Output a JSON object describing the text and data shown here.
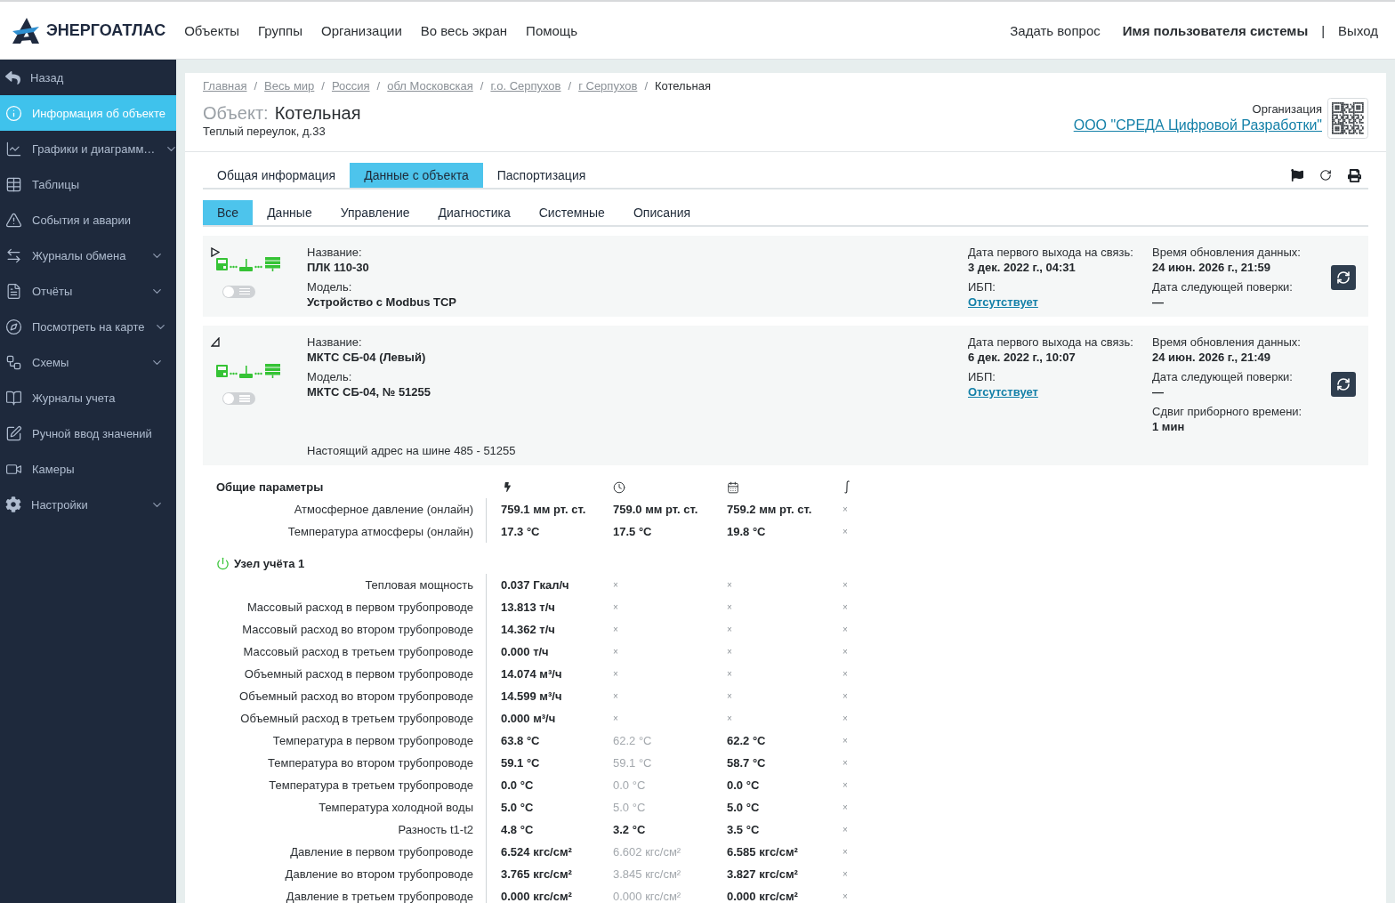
{
  "header": {
    "logo": "ЭНЕРГОАТЛАС",
    "nav": [
      "Объекты",
      "Группы",
      "Организации",
      "Во весь экран",
      "Помощь"
    ],
    "ask": "Задать вопрос",
    "user": "Имя пользователя системы",
    "separator": "|",
    "logout": "Выход"
  },
  "sidebar": {
    "items": [
      {
        "label": "Назад",
        "selected": false,
        "submenu": false
      },
      {
        "label": "Информация об объекте",
        "selected": true,
        "submenu": false
      },
      {
        "label": "Графики и диаграмм…",
        "selected": false,
        "submenu": true
      },
      {
        "label": "Таблицы",
        "selected": false,
        "submenu": false
      },
      {
        "label": "События и аварии",
        "selected": false,
        "submenu": false
      },
      {
        "label": "Журналы обмена",
        "selected": false,
        "submenu": true
      },
      {
        "label": "Отчёты",
        "selected": false,
        "submenu": true
      },
      {
        "label": "Посмотреть на карте",
        "selected": false,
        "submenu": true
      },
      {
        "label": "Схемы",
        "selected": false,
        "submenu": true
      },
      {
        "label": "Журналы учета",
        "selected": false,
        "submenu": false
      },
      {
        "label": "Ручной ввод значений",
        "selected": false,
        "submenu": false
      },
      {
        "label": "Камеры",
        "selected": false,
        "submenu": false
      },
      {
        "label": "Настройки",
        "selected": false,
        "submenu": true
      }
    ]
  },
  "breadcrumb": [
    {
      "kind": "link",
      "label": "Главная"
    },
    {
      "kind": "separator",
      "label": "/"
    },
    {
      "kind": "link",
      "label": "Весь мир"
    },
    {
      "kind": "separator",
      "label": "/"
    },
    {
      "kind": "link",
      "label": "Россия"
    },
    {
      "kind": "separator",
      "label": "/"
    },
    {
      "kind": "link",
      "label": "обл Московская"
    },
    {
      "kind": "separator",
      "label": "/"
    },
    {
      "kind": "link",
      "label": "г.о. Серпухов"
    },
    {
      "kind": "separator",
      "label": "/"
    },
    {
      "kind": "link",
      "label": "г Серпухов"
    },
    {
      "kind": "separator",
      "label": "/"
    },
    {
      "kind": "current",
      "label": "Котельная"
    }
  ],
  "object": {
    "label": "Объект:",
    "name": "Котельная",
    "address": "Теплый переулок, д.33"
  },
  "organization": {
    "label": "Организация",
    "name": "ООО \"СРЕДА Цифровой Разработки\""
  },
  "tabs": [
    {
      "label": "Общая информация",
      "selected": false
    },
    {
      "label": "Данные с объекта",
      "selected": true
    },
    {
      "label": "Паспортизация",
      "selected": false
    }
  ],
  "subtabs": [
    {
      "label": "Все",
      "selected": true
    },
    {
      "label": "Данные",
      "selected": false
    },
    {
      "label": "Управление",
      "selected": false
    },
    {
      "label": "Диагностика",
      "selected": false
    },
    {
      "label": "Системные",
      "selected": false
    },
    {
      "label": "Описания",
      "selected": false
    }
  ],
  "devices": [
    {
      "expanded": false,
      "enabled": false,
      "main": [
        {
          "label": "Название:",
          "value": "ПЛК 110-30"
        },
        {
          "label": "Модель:",
          "value": "Устройство с Modbus TCP"
        }
      ],
      "info": [
        {
          "label": "Дата первого выхода на связь:",
          "value": "3 дек. 2022 г., 04:31",
          "kind": "text"
        },
        {
          "label": "ИБП:",
          "value": "Отсутствует",
          "kind": "link"
        }
      ],
      "status": [
        {
          "label": "Время обновления данных:",
          "value": "24 июн. 2026 г., 21:59"
        },
        {
          "label": "Дата следующей поверки:",
          "value": "—"
        }
      ]
    },
    {
      "expanded": true,
      "enabled": false,
      "main": [
        {
          "label": "Название:",
          "value": "МКТС СБ-04 (Левый)"
        },
        {
          "label": "Модель:",
          "value": "МКТС СБ-04, № 51255"
        }
      ],
      "info": [
        {
          "label": "Дата первого выхода на связь:",
          "value": "6 дек. 2022 г., 10:07",
          "kind": "text"
        },
        {
          "label": "ИБП:",
          "value": "Отсутствует",
          "kind": "link"
        }
      ],
      "status": [
        {
          "label": "Время обновления данных:",
          "value": "24 июн. 2026 г., 21:49"
        },
        {
          "label": "Дата следующей поверки:",
          "value": "—"
        },
        {
          "label": "Сдвиг приборного времени:",
          "value": "1 мин"
        }
      ],
      "note": "Настоящий адрес на шине 485 - 51255"
    }
  ],
  "parameters": [
    {
      "title": "Общие параметры",
      "kind": "general",
      "rows": [
        {
          "label": "Атмосферное давление (онлайн)",
          "cells": [
            {
              "text": "759.1 мм рт. ст.",
              "kind": "value"
            },
            {
              "text": "759.0 мм рт. ст.",
              "kind": "value"
            },
            {
              "text": "759.2 мм рт. ст.",
              "kind": "value"
            },
            {
              "text": "×",
              "kind": "none"
            }
          ]
        },
        {
          "label": "Температура атмосферы (онлайн)",
          "cells": [
            {
              "text": "17.3 °C",
              "kind": "value"
            },
            {
              "text": "17.5 °C",
              "kind": "value"
            },
            {
              "text": "19.8 °C",
              "kind": "value"
            },
            {
              "text": "×",
              "kind": "none"
            }
          ]
        }
      ]
    },
    {
      "title": "Узел учёта 1",
      "kind": "node",
      "rows": [
        {
          "label": "Тепловая мощность",
          "cells": [
            {
              "text": "0.037 Гкал/ч",
              "kind": "value"
            },
            {
              "text": "×",
              "kind": "none"
            },
            {
              "text": "×",
              "kind": "none"
            },
            {
              "text": "×",
              "kind": "none"
            }
          ]
        },
        {
          "label": "Массовый расход в первом трубопроводе",
          "cells": [
            {
              "text": "13.813 т/ч",
              "kind": "value"
            },
            {
              "text": "×",
              "kind": "none"
            },
            {
              "text": "×",
              "kind": "none"
            },
            {
              "text": "×",
              "kind": "none"
            }
          ]
        },
        {
          "label": "Массовый расход во втором трубопроводе",
          "cells": [
            {
              "text": "14.362 т/ч",
              "kind": "value"
            },
            {
              "text": "×",
              "kind": "none"
            },
            {
              "text": "×",
              "kind": "none"
            },
            {
              "text": "×",
              "kind": "none"
            }
          ]
        },
        {
          "label": "Массовый расход в третьем трубопроводе",
          "cells": [
            {
              "text": "0.000 т/ч",
              "kind": "value"
            },
            {
              "text": "×",
              "kind": "none"
            },
            {
              "text": "×",
              "kind": "none"
            },
            {
              "text": "×",
              "kind": "none"
            }
          ]
        },
        {
          "label": "Объемный расход в первом трубопроводе",
          "cells": [
            {
              "text": "14.074 м³/ч",
              "kind": "value"
            },
            {
              "text": "×",
              "kind": "none"
            },
            {
              "text": "×",
              "kind": "none"
            },
            {
              "text": "×",
              "kind": "none"
            }
          ]
        },
        {
          "label": "Объемный расход во втором трубопроводе",
          "cells": [
            {
              "text": "14.599 м³/ч",
              "kind": "value"
            },
            {
              "text": "×",
              "kind": "none"
            },
            {
              "text": "×",
              "kind": "none"
            },
            {
              "text": "×",
              "kind": "none"
            }
          ]
        },
        {
          "label": "Объемный расход в третьем трубопроводе",
          "cells": [
            {
              "text": "0.000 м³/ч",
              "kind": "value"
            },
            {
              "text": "×",
              "kind": "none"
            },
            {
              "text": "×",
              "kind": "none"
            },
            {
              "text": "×",
              "kind": "none"
            }
          ]
        },
        {
          "label": "Температура в первом трубопроводе",
          "cells": [
            {
              "text": "63.8 °C",
              "kind": "value"
            },
            {
              "text": "62.2 °C",
              "kind": "muted"
            },
            {
              "text": "62.2 °C",
              "kind": "value"
            },
            {
              "text": "×",
              "kind": "none"
            }
          ]
        },
        {
          "label": "Температура во втором трубопроводе",
          "cells": [
            {
              "text": "59.1 °C",
              "kind": "value"
            },
            {
              "text": "59.1 °C",
              "kind": "muted"
            },
            {
              "text": "58.7 °C",
              "kind": "value"
            },
            {
              "text": "×",
              "kind": "none"
            }
          ]
        },
        {
          "label": "Температура в третьем трубопроводе",
          "cells": [
            {
              "text": "0.0 °C",
              "kind": "value"
            },
            {
              "text": "0.0 °C",
              "kind": "muted"
            },
            {
              "text": "0.0 °C",
              "kind": "value"
            },
            {
              "text": "×",
              "kind": "none"
            }
          ]
        },
        {
          "label": "Температура холодной воды",
          "cells": [
            {
              "text": "5.0 °C",
              "kind": "value"
            },
            {
              "text": "5.0 °C",
              "kind": "muted"
            },
            {
              "text": "5.0 °C",
              "kind": "value"
            },
            {
              "text": "×",
              "kind": "none"
            }
          ]
        },
        {
          "label": "Разность t1-t2",
          "cells": [
            {
              "text": "4.8 °C",
              "kind": "value"
            },
            {
              "text": "3.2 °C",
              "kind": "value"
            },
            {
              "text": "3.5 °C",
              "kind": "value"
            },
            {
              "text": "×",
              "kind": "none"
            }
          ]
        },
        {
          "label": "Давление в первом трубопроводе",
          "cells": [
            {
              "text": "6.524 кгс/см²",
              "kind": "value"
            },
            {
              "text": "6.602 кгс/см²",
              "kind": "muted"
            },
            {
              "text": "6.585 кгс/см²",
              "kind": "value"
            },
            {
              "text": "×",
              "kind": "none"
            }
          ]
        },
        {
          "label": "Давление во втором трубопроводе",
          "cells": [
            {
              "text": "3.765 кгс/см²",
              "kind": "value"
            },
            {
              "text": "3.845 кгс/см²",
              "kind": "muted"
            },
            {
              "text": "3.827 кгс/см²",
              "kind": "value"
            },
            {
              "text": "×",
              "kind": "none"
            }
          ]
        },
        {
          "label": "Давление в третьем трубопроводе",
          "cells": [
            {
              "text": "0.000 кгс/см²",
              "kind": "value"
            },
            {
              "text": "0.000 кгс/см²",
              "kind": "muted"
            },
            {
              "text": "0.000 кгс/см²",
              "kind": "value"
            },
            {
              "text": "×",
              "kind": "none"
            }
          ]
        }
      ]
    }
  ]
}
